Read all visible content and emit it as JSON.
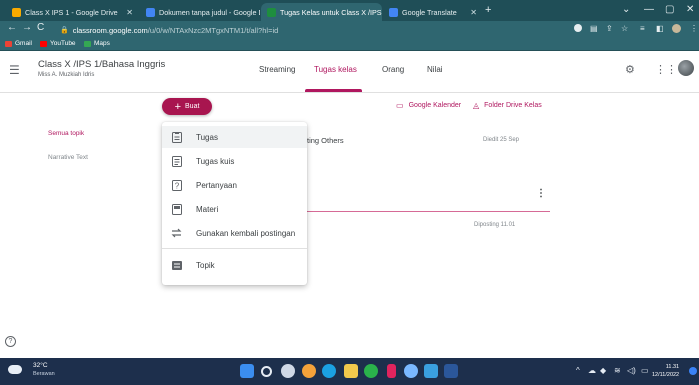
{
  "browser": {
    "tabs": [
      {
        "label": "Class X IPS 1 - Google Drive",
        "active": false,
        "color": "#f9ab00"
      },
      {
        "label": "Dokumen tanpa judul - Google Do",
        "active": false,
        "color": "#4285f4"
      },
      {
        "label": "Tugas Kelas untuk Class X /IPS 1",
        "active": true,
        "color": "#1e8e3e"
      },
      {
        "label": "Google Translate",
        "active": false,
        "color": "#4285f4"
      }
    ],
    "url_domain": "classroom.google.com",
    "url_path": "/u/0/w/NTAxNzc2MTgxNTM1/t/all?hl=id",
    "bookmarks": [
      "Gmail",
      "YouTube",
      "Maps"
    ]
  },
  "classroom": {
    "class_title": "Class X /IPS 1/Bahasa Inggris",
    "teacher": "Miss A. Muzkiah Idris",
    "nav_tabs": [
      {
        "label": "Streaming",
        "active": false
      },
      {
        "label": "Tugas kelas",
        "active": true
      },
      {
        "label": "Orang",
        "active": false
      },
      {
        "label": "Nilai",
        "active": false
      }
    ],
    "create_label": "Buat",
    "calendar_link": "Google Kalender",
    "drive_link": "Folder Drive Kelas",
    "topics": [
      {
        "label": "Semua topik",
        "active": true
      },
      {
        "label": "Narrative Text",
        "active": false
      }
    ],
    "task_title_fragment": "ting Others",
    "task_due": "Diedit 25 Sep",
    "task_posted": "Diposting 11.01"
  },
  "create_menu": {
    "items": [
      {
        "label": "Tugas",
        "icon": "assignment-icon"
      },
      {
        "label": "Tugas kuis",
        "icon": "quiz-assignment-icon"
      },
      {
        "label": "Pertanyaan",
        "icon": "question-icon"
      },
      {
        "label": "Materi",
        "icon": "material-icon"
      },
      {
        "label": "Gunakan kembali postingan",
        "icon": "reuse-post-icon"
      },
      {
        "label": "Topik",
        "icon": "topic-icon"
      }
    ]
  },
  "taskbar": {
    "temperature": "32°C",
    "condition": "Berawan",
    "time": "11.31",
    "date": "12/11/2022"
  },
  "colors": {
    "accent": "#b0175f",
    "create_button": "#a8154f",
    "browser_frame": "#1f4e57",
    "taskbar": "#1d2f4c"
  }
}
